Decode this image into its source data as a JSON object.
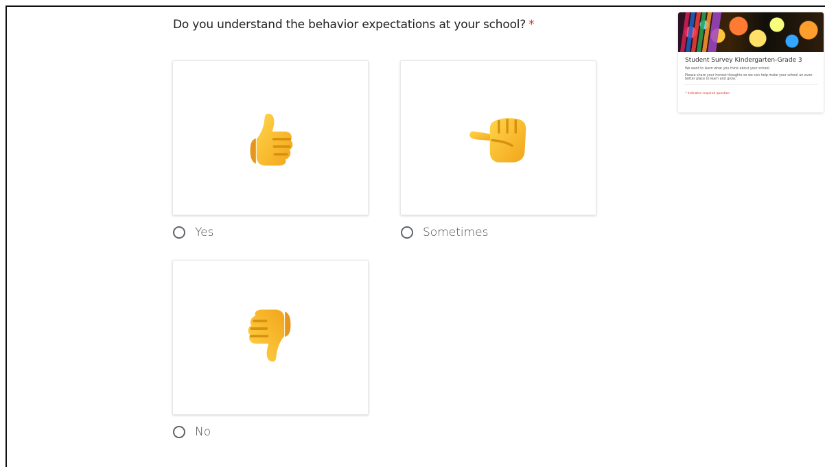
{
  "question": {
    "text": "Do you understand the behavior expectations at your school?",
    "required_marker": "*"
  },
  "options": [
    {
      "label": "Yes",
      "icon": "thumbs-up-icon"
    },
    {
      "label": "Sometimes",
      "icon": "sideways-thumb-icon"
    },
    {
      "label": "No",
      "icon": "thumbs-down-icon"
    }
  ],
  "thumbnail": {
    "title": "Student Survey Kindergarten-Grade 3",
    "line1": "We want to learn what you think about your school.",
    "line2": "Please share your honest thoughts so we can help make your school an even better place to learn and grow.",
    "required_note": "* Indicates required question"
  },
  "colors": {
    "accent_red": "#d93025",
    "emoji_yellow": "#f9b52c",
    "border_gray": "#e8e8e8"
  }
}
